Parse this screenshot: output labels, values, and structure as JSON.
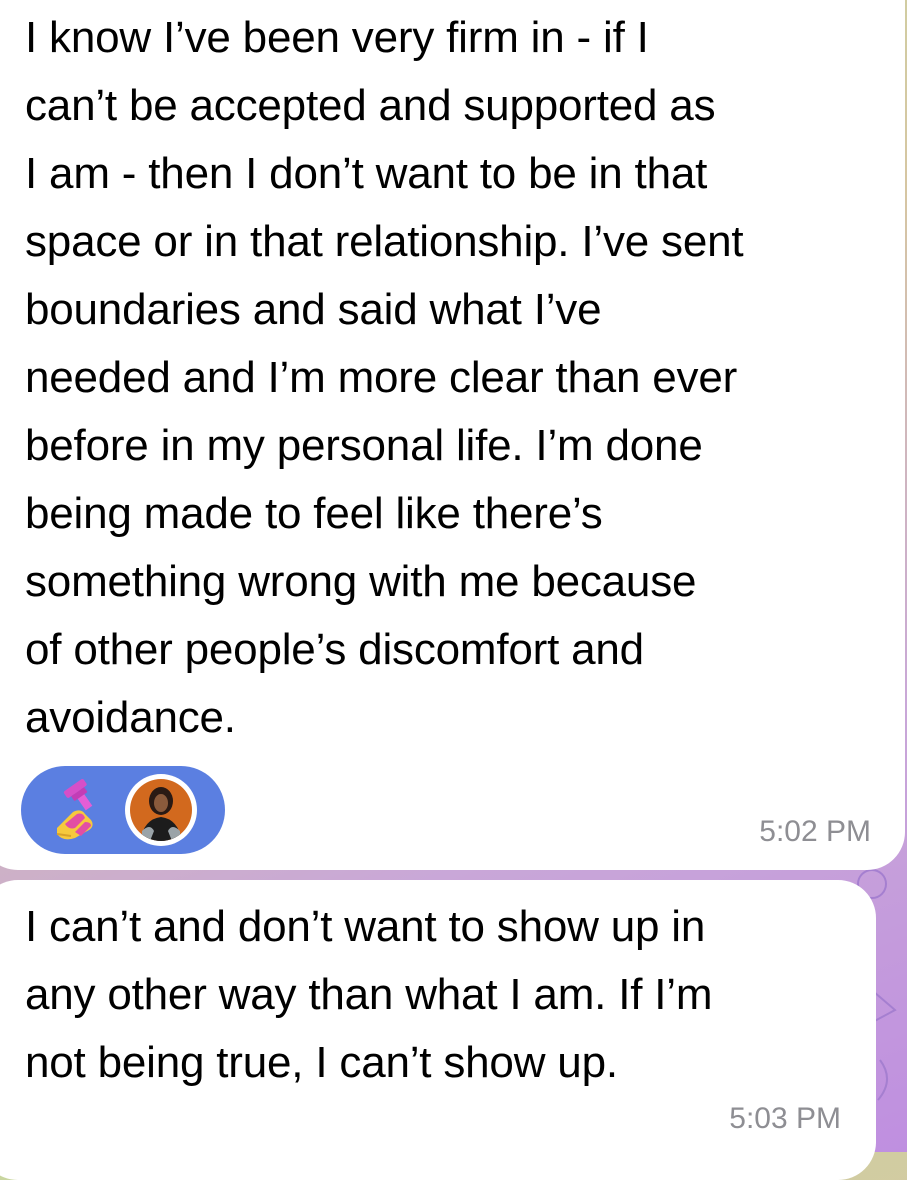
{
  "messages": [
    {
      "text": "I know I’ve been very firm in - if I\ncan’t be accepted and supported as\nI am - then I don’t want to be in that\nspace or in that relationship. I’ve sent\nboundaries and said what I’ve\nneeded and I’m more clear than ever\nbefore in my personal life. I’m done\nbeing made to feel like there’s\nsomething wrong with me because\nof other people’s discomfort and\navoidance.",
      "time": "5:02 PM",
      "reaction": {
        "emoji_icon": "nail-polish-icon",
        "reactor": "avatar"
      }
    },
    {
      "text": "I can’t and don’t want to show up in\nany other way than what I am. If I’m\nnot being true, I can’t show up.",
      "time": "5:03 PM"
    }
  ],
  "colors": {
    "bubble": "#ffffff",
    "reaction_pill": "#5b7fe1",
    "timestamp": "#8e8e93",
    "text": "#000000"
  }
}
